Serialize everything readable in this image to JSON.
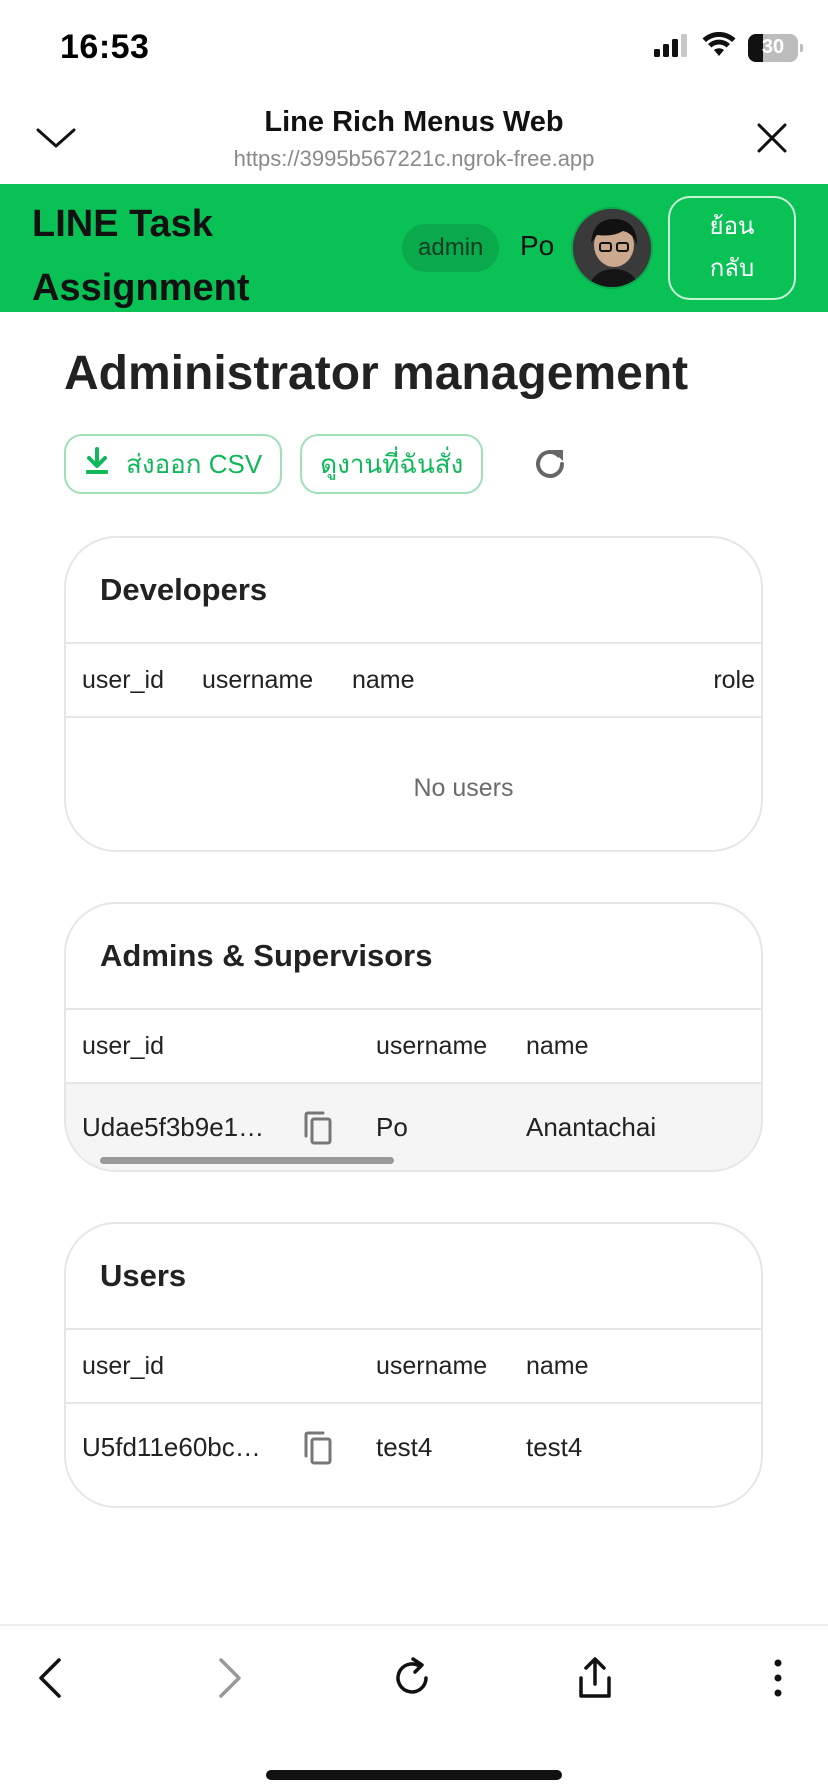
{
  "status_bar": {
    "time": "16:53",
    "battery": "30"
  },
  "browser": {
    "title": "Line Rich Menus Web",
    "url": "https://3995b567221c.ngrok-free.app"
  },
  "app": {
    "title": "LINE Task Assignment",
    "role": "admin",
    "user_name": "Po",
    "back_label_line1": "ย้อน",
    "back_label_line2": "กลับ",
    "accent_color": "#0ac156"
  },
  "page": {
    "title": "Administrator management",
    "export_csv_label": "ส่งออก CSV",
    "my_tasks_label": "ดูงานที่ฉันสั่ง"
  },
  "developers": {
    "title": "Developers",
    "columns": [
      "user_id",
      "username",
      "name",
      "role"
    ],
    "empty_text": "No users"
  },
  "admins": {
    "title": "Admins & Supervisors",
    "columns": [
      "user_id",
      "username",
      "name"
    ],
    "rows": [
      {
        "user_id": "Udae5f3b9e1…",
        "username": "Po",
        "name": "Anantachai"
      }
    ]
  },
  "users": {
    "title": "Users",
    "columns": [
      "user_id",
      "username",
      "name"
    ],
    "rows": [
      {
        "user_id": "U5fd11e60bc…",
        "username": "test4",
        "name": "test4"
      }
    ]
  }
}
